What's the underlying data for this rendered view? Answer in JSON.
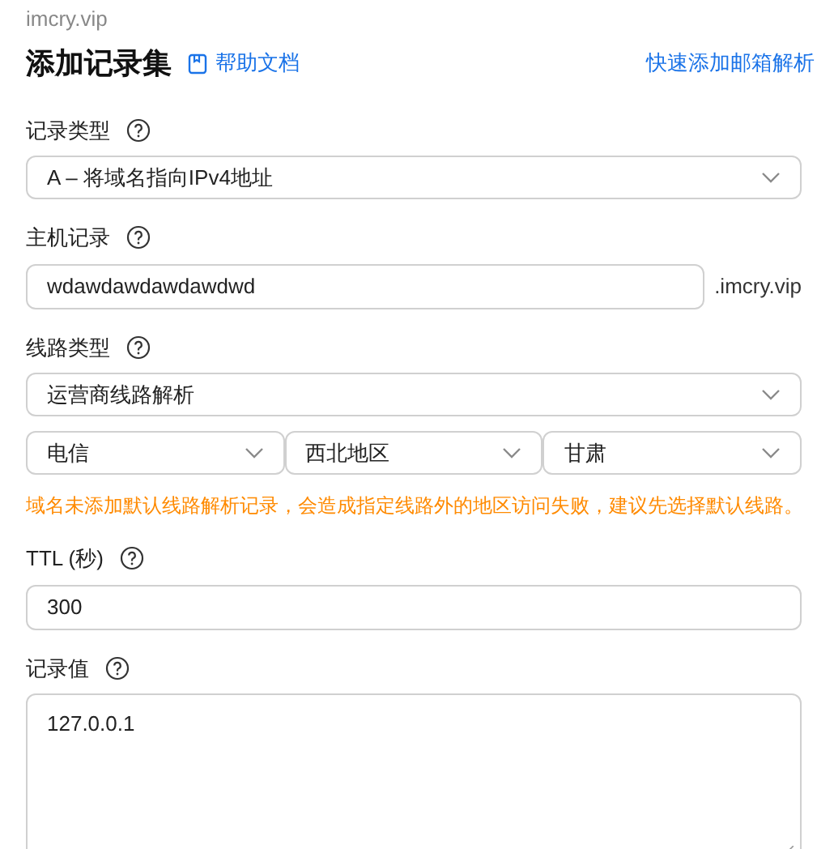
{
  "domain": "imcry.vip",
  "title": "添加记录集",
  "help_link": "帮助文档",
  "quick_link": "快速添加邮箱解析",
  "fields": [
    {
      "kind": "select",
      "label": "记录类型",
      "value": "A – 将域名指向IPv4地址"
    },
    {
      "kind": "suffix",
      "label": "主机记录",
      "value": "wdawdawdawdawdwd",
      "suffix": ".imcry.vip"
    },
    {
      "kind": "line",
      "label": "线路类型",
      "value": "运营商线路解析",
      "subselects": [
        "电信",
        "西北地区",
        "甘肃"
      ],
      "warning": "域名未添加默认线路解析记录，会造成指定线路外的地区访问失败，建议先选择默认线路。"
    },
    {
      "kind": "input",
      "label": "TTL (秒)",
      "value": "300"
    },
    {
      "kind": "textarea",
      "label": "记录值",
      "value": "127.0.0.1"
    }
  ]
}
